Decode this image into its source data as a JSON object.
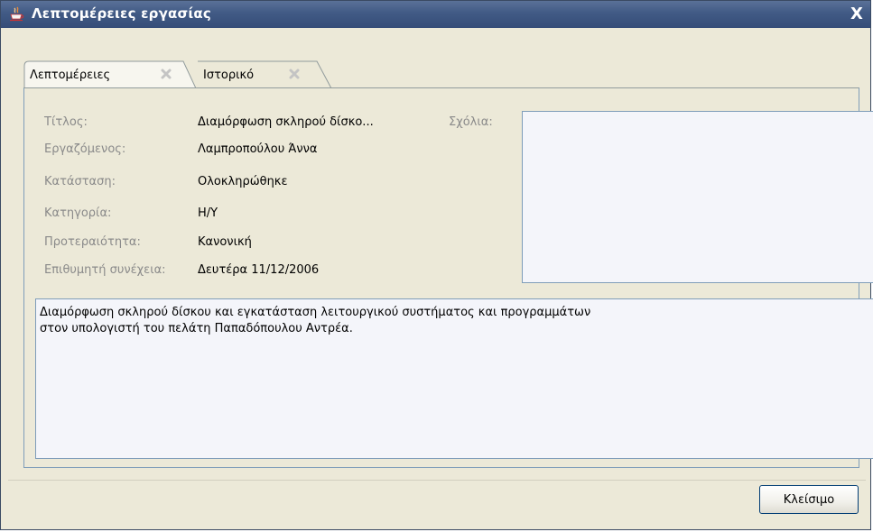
{
  "window": {
    "title": "Λεπτομέρειες εργασίας",
    "close_glyph": "X"
  },
  "tabs": [
    {
      "label": "Λεπτομέρειες",
      "active": true
    },
    {
      "label": "Ιστορικό",
      "active": false
    }
  ],
  "details": {
    "fields": [
      {
        "label": "Τίτλος:",
        "value": "Διαμόρφωση σκληρού δίσκο..."
      },
      {
        "label": "Εργαζόμενος:",
        "value": "Λαμπροπούλου Άννα"
      },
      {
        "label": "Κατάσταση:",
        "value": "Ολοκληρώθηκε"
      },
      {
        "label": "Κατηγορία:",
        "value": "Η/Υ"
      },
      {
        "label": "Προτεραιότητα:",
        "value": "Κανονική"
      },
      {
        "label": "Επιθυμητή συνέχεια:",
        "value": "Δευτέρα 11/12/2006"
      }
    ],
    "comments_label": "Σχόλια:",
    "comments_value": "",
    "description_lines": [
      "Διαμόρφωση σκληρού δίσκου και εγκατάσταση λειτουργικού συστήματος και προγραμμάτων",
      "στον υπολογιστή του πελάτη Παπαδόπουλου Αντρέα."
    ]
  },
  "footer": {
    "close_label": "Κλείσιμο"
  },
  "colors": {
    "titlebar": "#415a85",
    "window_bg": "#ece9d8",
    "field_bg": "#f4f5fa",
    "field_border": "#7f9db9",
    "label_text": "#8a8a8a"
  }
}
